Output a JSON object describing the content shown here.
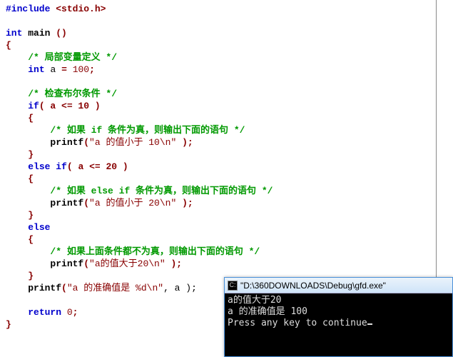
{
  "code": {
    "include": "#include",
    "header": "<stdio.h>",
    "int": "int",
    "main": "main",
    "paren_empty": "()",
    "brace_open": "{",
    "brace_close": "}",
    "comment_local": "/* 局部变量定义 */",
    "decl_a": "a",
    "eq": "=",
    "num100": "100",
    "semi": ";",
    "comment_check": "/* 检查布尔条件 */",
    "if": "if",
    "cond1": "( a <= 10 )",
    "comment_if_true": "/* 如果 if 条件为真，则输出下面的语句 */",
    "printf": "printf",
    "str_lt10": "\"a 的值小于 10\\n\"",
    "rparen_semi": ");",
    "else": "else",
    "cond2": "( a <= 20 )",
    "comment_elseif_true": "/* 如果 else if 条件为真，则输出下面的语句 */",
    "str_lt20": "\"a 的值小于 20\\n\"",
    "comment_else": "/* 如果上面条件都不为真，则输出下面的语句 */",
    "str_gt20": "\"a的值大于20\\n\"",
    "str_exact": "\"a 的准确值是 %d\\n\"",
    "args_a": ", a );",
    "return": "return",
    "num0": "0"
  },
  "console": {
    "title": "\"D:\\360DOWNLOADS\\Debug\\gfd.exe\"",
    "line1": "a的值大于20",
    "line2": "a 的准确值是 100",
    "line3": "Press any key to continue"
  }
}
